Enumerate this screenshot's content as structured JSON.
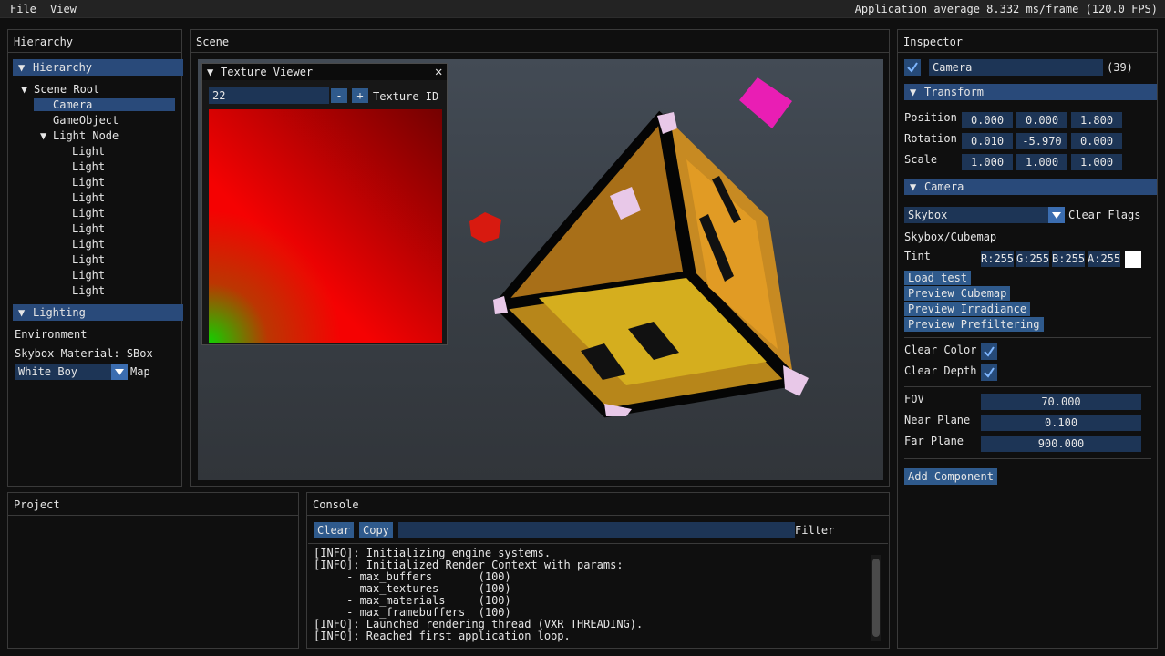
{
  "menubar": {
    "file": "File",
    "view": "View",
    "fps": "Application average 8.332 ms/frame (120.0 FPS)"
  },
  "hierarchy": {
    "panel_title": "Hierarchy",
    "header": "Hierarchy",
    "root": "Scene Root",
    "camera": "Camera",
    "gameobject": "GameObject",
    "light_node": "Light Node",
    "lights": [
      "Light",
      "Light",
      "Light",
      "Light",
      "Light",
      "Light",
      "Light",
      "Light",
      "Light",
      "Light"
    ],
    "lighting_header": "Lighting",
    "environment": "Environment",
    "skybox_material": "Skybox Material: SBox",
    "map_value": "White Boy",
    "map_label": "Map"
  },
  "scene": {
    "panel_title": "Scene",
    "texture_viewer": {
      "title": "Texture Viewer",
      "id_value": "22",
      "minus": "-",
      "plus": "+",
      "id_label": "Texture ID"
    }
  },
  "inspector": {
    "panel_title": "Inspector",
    "object_name": "Camera",
    "object_id": "(39)",
    "transform_header": "Transform",
    "position_label": "Position",
    "position": [
      "0.000",
      "0.000",
      "1.800"
    ],
    "rotation_label": "Rotation",
    "rotation": [
      "0.010",
      "-5.970",
      "0.000"
    ],
    "scale_label": "Scale",
    "scale": [
      "1.000",
      "1.000",
      "1.000"
    ],
    "camera_header": "Camera",
    "clear_flags_value": "Skybox",
    "clear_flags_label": "Clear Flags",
    "skybox_cubemap": "Skybox/Cubemap",
    "tint_label": "Tint",
    "tint": [
      "R:255",
      "G:255",
      "B:255",
      "A:255"
    ],
    "load_test": "Load test",
    "preview_cubemap": "Preview Cubemap",
    "preview_irradiance": "Preview Irradiance",
    "preview_prefiltering": "Preview Prefiltering",
    "clear_color": "Clear Color",
    "clear_depth": "Clear Depth",
    "fov_label": "FOV",
    "fov": "70.000",
    "near_label": "Near Plane",
    "near": "0.100",
    "far_label": "Far Plane",
    "far": "900.000",
    "add_component": "Add Component"
  },
  "project": {
    "panel_title": "Project"
  },
  "console": {
    "panel_title": "Console",
    "clear": "Clear",
    "copy": "Copy",
    "filter_value": "",
    "filter_label": "Filter",
    "lines": [
      "[INFO]: Initializing engine systems.",
      "[INFO]: Initialized Render Context with params:",
      "     - max_buffers       (100)",
      "     - max_textures      (100)",
      "     - max_materials     (100)",
      "     - max_framebuffers  (100)",
      "[INFO]: Launched rendering thread (VXR_THREADING).",
      "[INFO]: Reached first application loop."
    ]
  }
}
